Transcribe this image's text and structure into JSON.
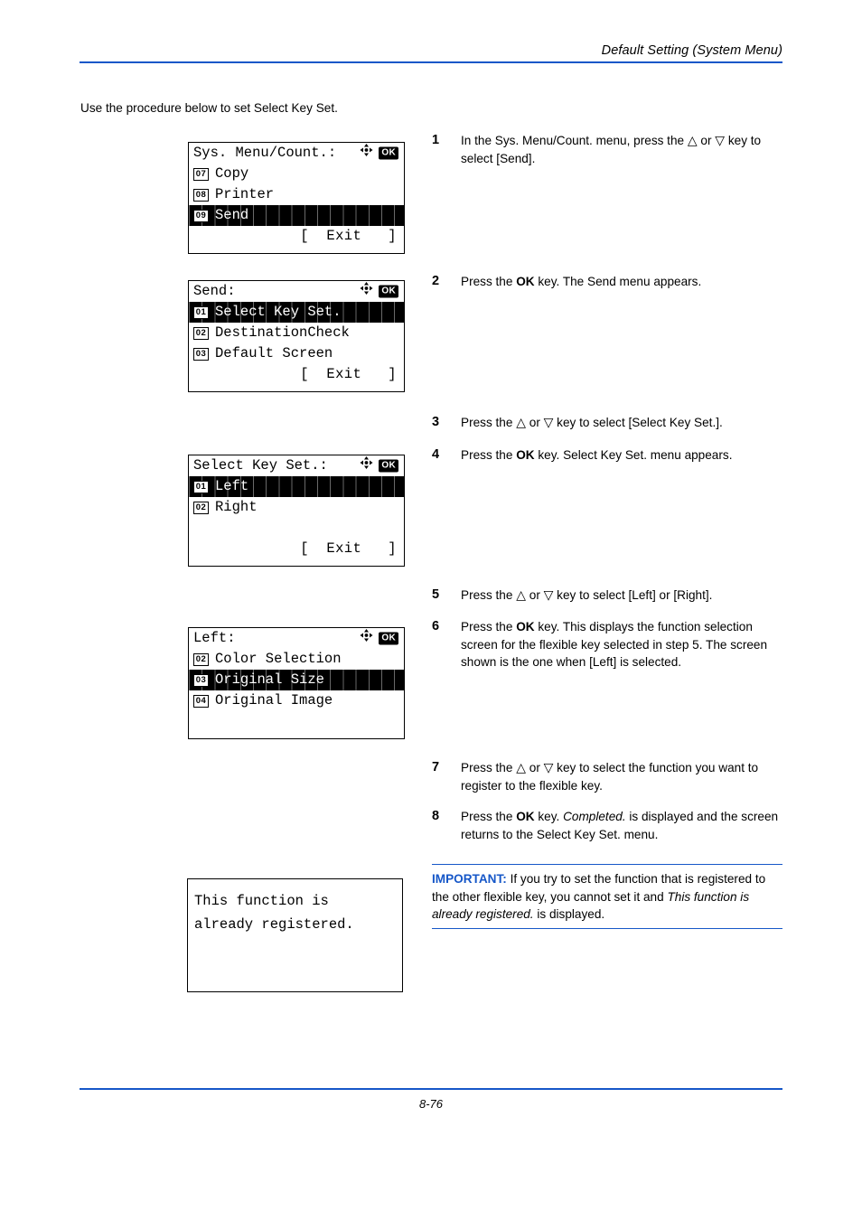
{
  "header": {
    "title": "Default Setting (System Menu)"
  },
  "intro": "Use the procedure below to set Select Key Set.",
  "footer": {
    "page": "8-76"
  },
  "colors": {
    "rule_blue": "#1657c8",
    "important_label": "#1657c8",
    "lcd_background": "#ffffff",
    "lcd_text": "#000000",
    "lcd_highlight_background": "#000000",
    "lcd_highlight_text": "#ffffff"
  },
  "icons": {
    "nav": "four-way-arrow-icon",
    "ok": "OK"
  },
  "panels": [
    {
      "name": "sys-menu-count",
      "title": "Sys. Menu/Count.:",
      "rows": [
        {
          "index": "07",
          "label": "Copy",
          "highlight": false
        },
        {
          "index": "08",
          "label": "Printer",
          "highlight": false
        },
        {
          "index": "09",
          "label": "Send",
          "highlight": true
        }
      ],
      "exit": "[  Exit   ]"
    },
    {
      "name": "send-menu",
      "title": "Send:",
      "rows": [
        {
          "index": "01",
          "label": "Select Key Set.",
          "highlight": true
        },
        {
          "index": "02",
          "label": "DestinationCheck",
          "highlight": false
        },
        {
          "index": "03",
          "label": "Default Screen",
          "highlight": false
        }
      ],
      "exit": "[  Exit   ]"
    },
    {
      "name": "select-key-set-menu",
      "title": "Select Key Set.:",
      "rows": [
        {
          "index": "01",
          "label": "Left",
          "highlight": true
        },
        {
          "index": "02",
          "label": "Right",
          "highlight": false
        }
      ],
      "exit": "[  Exit   ]"
    },
    {
      "name": "left-function-menu",
      "title": "Left:",
      "rows": [
        {
          "index": "02",
          "label": "Color Selection",
          "highlight": false
        },
        {
          "index": "03",
          "label": "Original Size",
          "highlight": true
        },
        {
          "index": "04",
          "label": "Original Image",
          "highlight": false
        }
      ],
      "exit": ""
    },
    {
      "name": "already-registered-message",
      "message_line1": "This function is",
      "message_line2": "already registered."
    }
  ],
  "steps": [
    {
      "number": "1",
      "text_before": "In the Sys. Menu/Count. menu, press the ",
      "up": "△",
      "or": " or ",
      "down": "▽",
      "text_after": " key to select [Send]."
    },
    {
      "number": "2",
      "text_before": "Press the ",
      "bold": "OK",
      "text_after": " key. The Send menu appears."
    },
    {
      "number": "3",
      "text_before": "Press the ",
      "up": "△",
      "or": " or ",
      "down": "▽",
      "text_after": " key to select [Select Key Set.]."
    },
    {
      "number": "4",
      "text_before": "Press the ",
      "bold": "OK",
      "text_after": " key. Select Key Set. menu appears."
    },
    {
      "number": "5",
      "text_before": "Press the ",
      "up": "△",
      "or": " or ",
      "down": "▽",
      "text_after": " key to select [Left] or [Right]."
    },
    {
      "number": "6",
      "text_before": "Press the ",
      "bold": "OK",
      "text_after": " key. This displays the function selection screen for the flexible key selected in step 5. The screen shown is the one when [Left] is selected."
    },
    {
      "number": "7",
      "text_before": "Press the ",
      "up": "△",
      "or": " or ",
      "down": "▽",
      "text_after": " key to select the function you want to register to the flexible key."
    },
    {
      "number": "8",
      "text_before": "Press the ",
      "bold": "OK",
      "text_mid": " key. ",
      "italic": "Completed.",
      "text_after": " is displayed and the screen returns to the Select Key Set. menu."
    }
  ],
  "note": {
    "label": "IMPORTANT:",
    "text_before": " If you try to set the function that is registered to the other flexible key, you cannot set it and ",
    "italic": "This function is already registered.",
    "text_after": " is displayed."
  }
}
